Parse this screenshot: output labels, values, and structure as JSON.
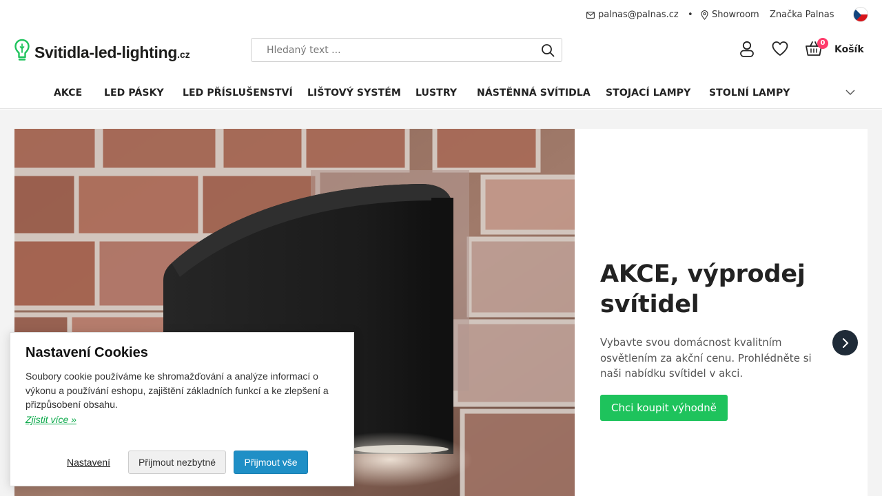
{
  "topbar": {
    "email": "palnas@palnas.cz",
    "separator": "•",
    "showroom": "Showroom",
    "brand": "Značka Palnas",
    "language_flag": "cz-flag-icon"
  },
  "header": {
    "logo_main": "Svitidla-led-lighting",
    "logo_tld": ".cz",
    "search_placeholder": "Hledaný text ...",
    "cart_count": "0",
    "cart_label": "Košík"
  },
  "nav": {
    "items": [
      {
        "label": "AKCE"
      },
      {
        "label": "LED PÁSKY"
      },
      {
        "label": "LED PŘÍSLUŠENSTVÍ"
      },
      {
        "label": "LIŠTOVÝ SYSTÉM"
      },
      {
        "label": "LUSTRY"
      },
      {
        "label": "NÁSTĚNNÁ SVÍTIDLA"
      },
      {
        "label": "STOJACÍ LAMPY"
      },
      {
        "label": "STOLNÍ LAMPY"
      }
    ]
  },
  "hero": {
    "title": "AKCE, výprodej svítidel",
    "description": "Vybavte svou domácnost kvalitním osvětlením za akční cenu. Prohlédněte si naši nabídku svítidel v akci.",
    "cta": "Chci koupit výhodně"
  },
  "cookie": {
    "title": "Nastavení Cookies",
    "text": "Soubory cookie používáme ke shromažďování a analýze informací o výkonu a používání eshopu, zajištění základních funkcí a ke zlepšení a přizpůsobení obsahu.",
    "link": "Zjistit více »",
    "settings": "Nastavení",
    "accept_necessary": "Přijmout nezbytné",
    "accept_all": "Přijmout vše"
  },
  "colors": {
    "accent_green": "#1ec35c",
    "cookie_blue": "#1f8fc6",
    "badge_pink": "#ff3b6b",
    "slider_dark": "#1f2b38"
  }
}
